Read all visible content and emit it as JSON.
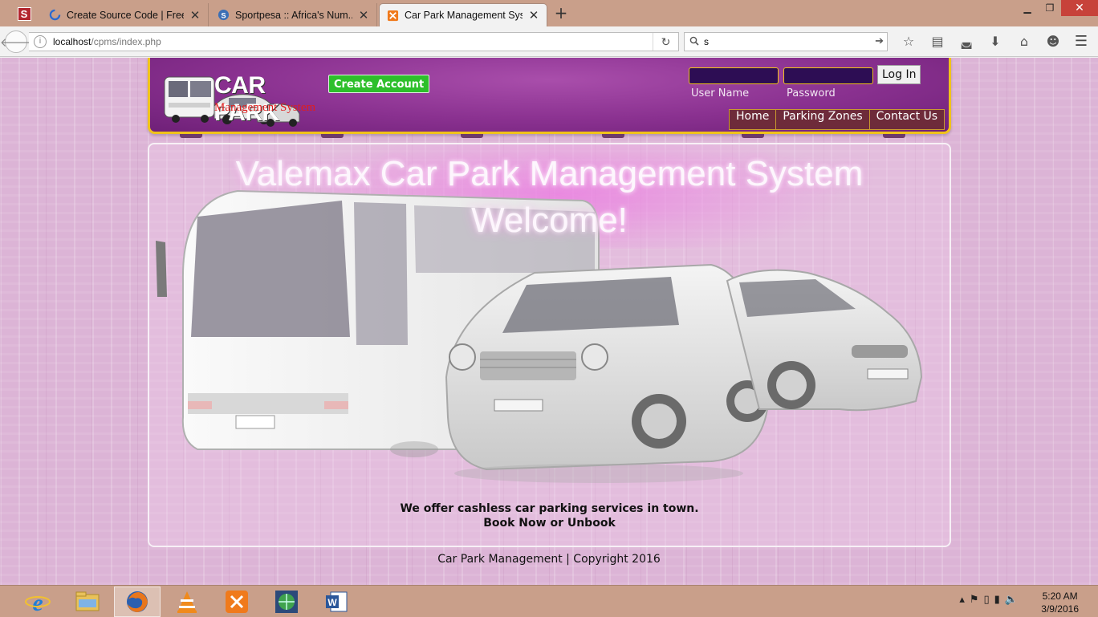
{
  "browser": {
    "tabs": [
      {
        "title": "Create Source Code | Free ...",
        "icon": "sourcecode-favicon",
        "active": false
      },
      {
        "title": "Sportpesa :: Africa's Num...",
        "icon": "sportpesa-favicon",
        "active": false
      },
      {
        "title": "Car Park Management Sys...",
        "icon": "xampp-favicon",
        "active": true
      }
    ],
    "pinned_icon": "S",
    "url_host": "localhost",
    "url_path": "/cpms/index.php",
    "search_value": "s"
  },
  "header": {
    "logo_title": "CAR PARK",
    "logo_subtitle": "Management System",
    "create_account_label": "Create Account",
    "username_label": "User Name",
    "password_label": "Password",
    "login_label": "Log In",
    "nav": [
      "Home",
      "Parking Zones",
      "Contact Us"
    ]
  },
  "hero": {
    "title_line1": "Valemax Car Park Management System",
    "title_line2": "Welcome!",
    "tagline_line1": "We offer cashless car parking services in town.",
    "tagline_line2": "Book Now or Unbook"
  },
  "footer": {
    "text": "Car Park Management | Copyright 2016"
  },
  "taskbar": {
    "time": "5:20 AM",
    "date": "3/9/2016"
  },
  "colors": {
    "header_purple": "#8a3190",
    "header_border": "#f0c21a",
    "create_account_green": "#2dbf2b",
    "page_pink": "#dcb4d6"
  }
}
